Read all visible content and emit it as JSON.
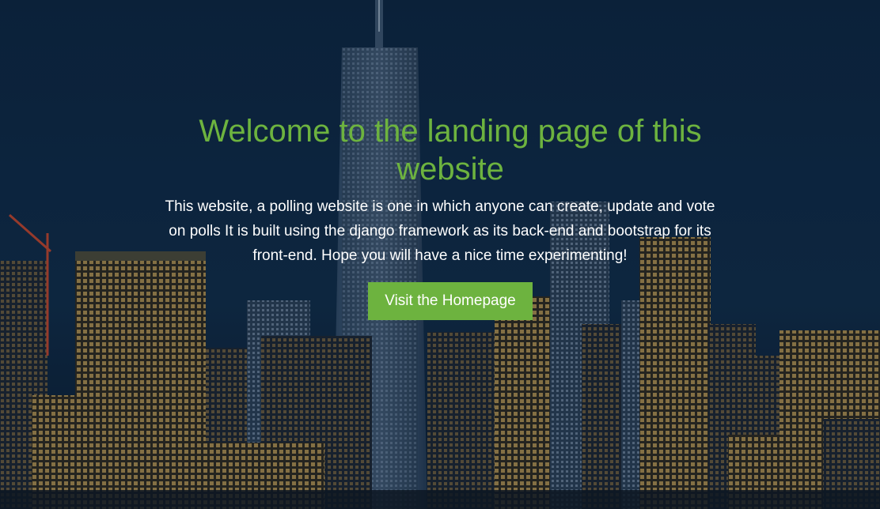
{
  "hero": {
    "title": "Welcome to the landing page of this website",
    "description": "This website, a polling website is one in which anyone can create, update and vote on polls It is built using the django framework as its back-end and bootstrap for its front-end. Hope you will have a nice time experimenting!",
    "button_label": "Visit the Homepage"
  },
  "colors": {
    "accent": "#6db33f",
    "text": "#ffffff",
    "sky": "#0f2a46"
  }
}
